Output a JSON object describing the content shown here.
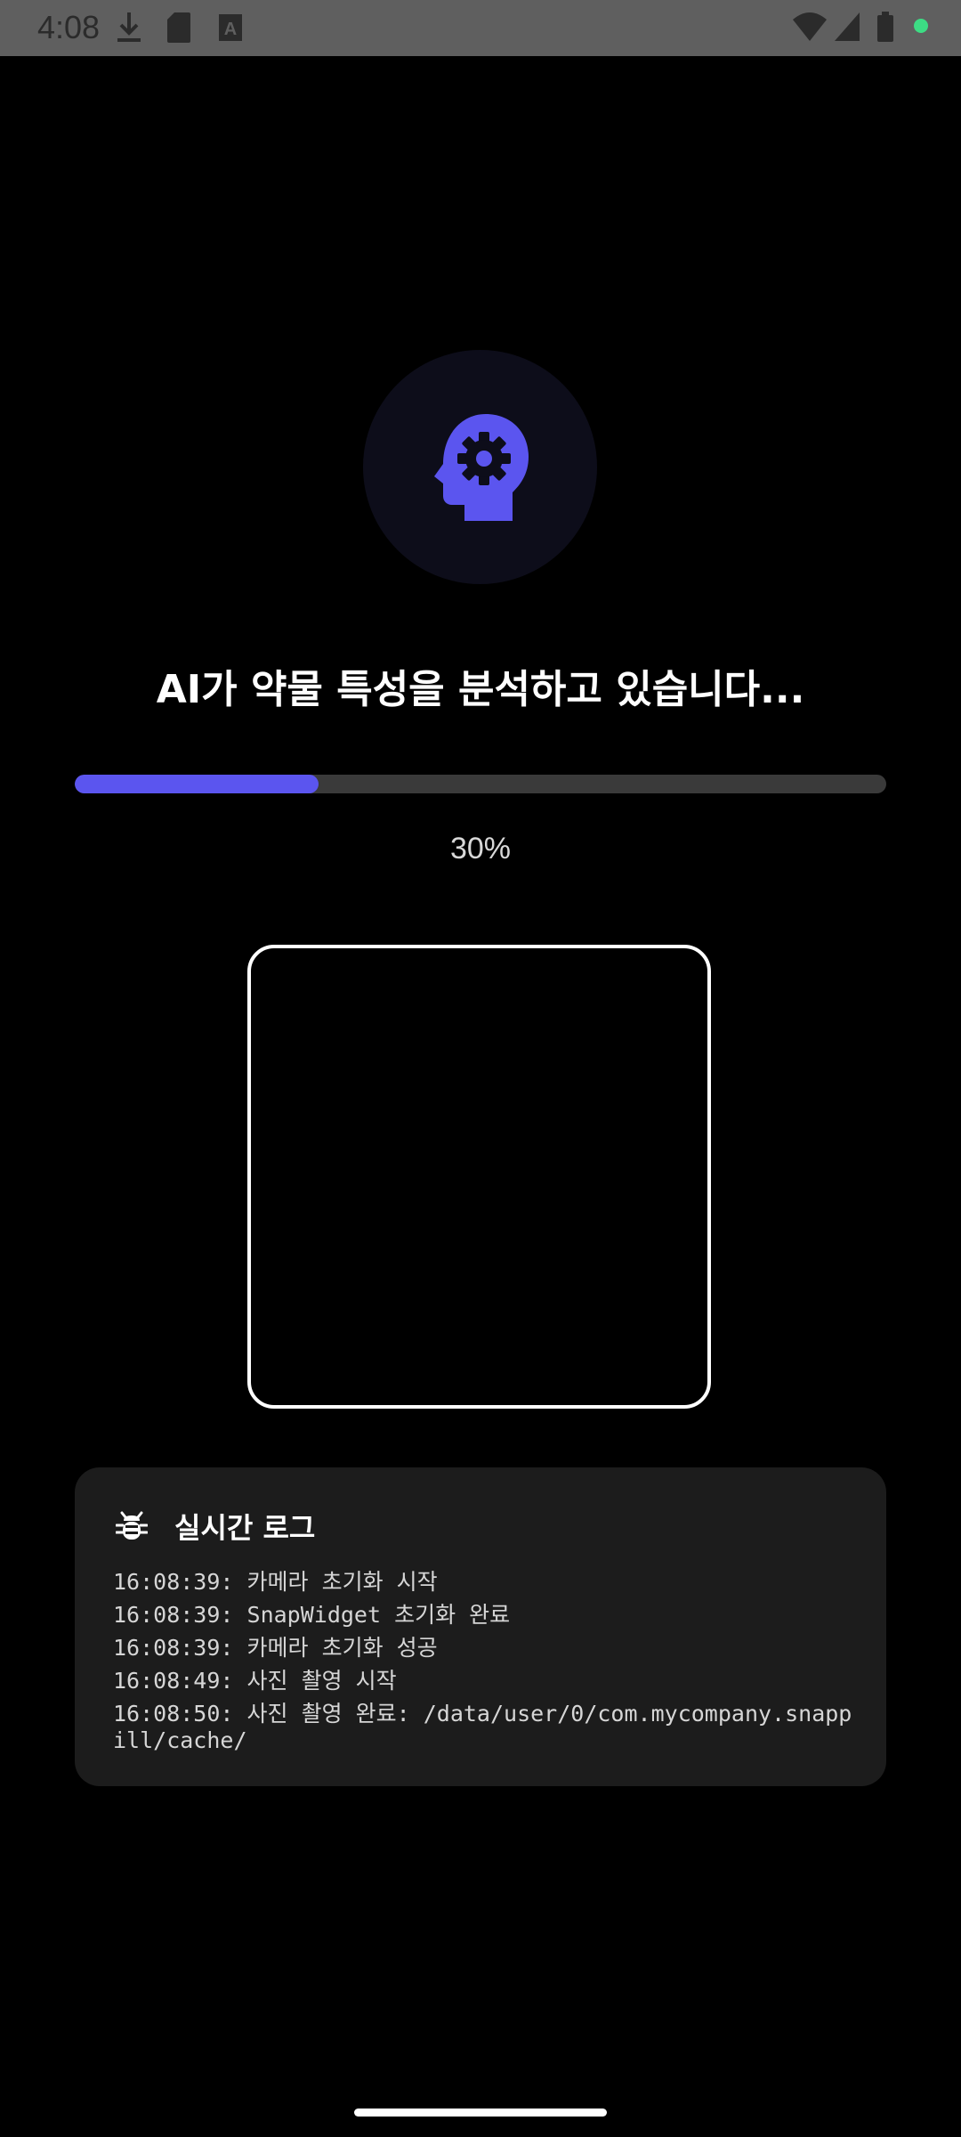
{
  "status_bar": {
    "time": "4:08",
    "icons": [
      "download-icon",
      "sd-card-icon",
      "keyboard-a-icon",
      "wifi-icon",
      "cellular-icon",
      "battery-icon",
      "camera-active-dot"
    ],
    "dot_color": "#3ddc84"
  },
  "analysis": {
    "icon": "ai-head-gear-icon",
    "accent_color": "#5b55ef",
    "title": "AI가 약물 특성을 분석하고 있습니다...",
    "progress_percent": 30,
    "progress_label": "30%"
  },
  "log": {
    "icon": "bug-icon",
    "title": "실시간 로그",
    "lines": [
      "16:08:39: 카메라 초기화 시작",
      "16:08:39: SnapWidget 초기화 완료",
      "16:08:39: 카메라 초기화 성공",
      "16:08:49: 사진 촬영 시작",
      "16:08:50: 사진 촬영 완료: /data/user/0/com.mycompany.snappill/cache/"
    ]
  }
}
